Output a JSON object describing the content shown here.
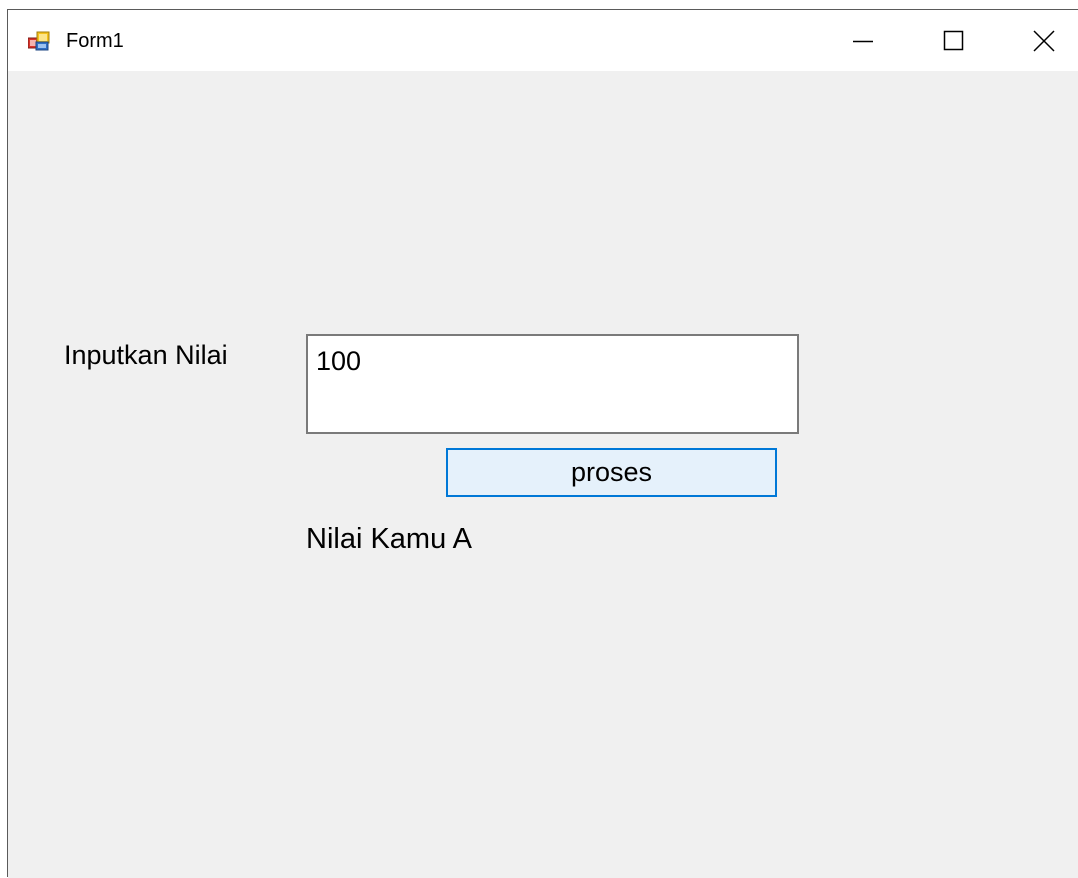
{
  "window": {
    "title": "Form1",
    "icon": "winforms-app-icon",
    "controls": {
      "minimize_icon": "minimize-icon",
      "maximize_icon": "maximize-icon",
      "close_icon": "close-icon"
    }
  },
  "form": {
    "input_label": "Inputkan Nilai",
    "input_value": "100",
    "button_label": "proses",
    "result_text": "Nilai Kamu A"
  },
  "colors": {
    "client_background": "#f0f0f0",
    "titlebar_background": "#ffffff",
    "button_background": "#e5f1fb",
    "button_border_focus": "#0078d7",
    "textbox_border": "#7a7a7a"
  }
}
